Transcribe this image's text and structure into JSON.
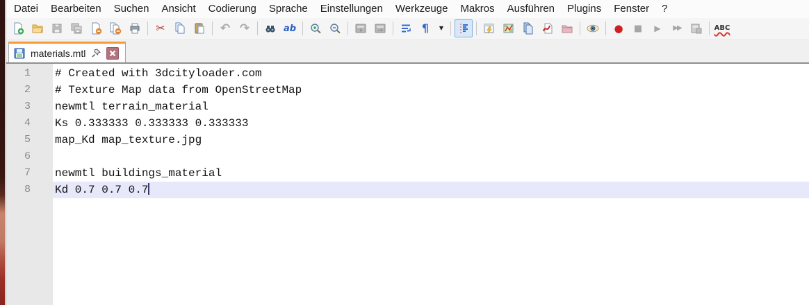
{
  "menu": {
    "items": [
      {
        "label": "Datei"
      },
      {
        "label": "Bearbeiten"
      },
      {
        "label": "Suchen"
      },
      {
        "label": "Ansicht"
      },
      {
        "label": "Codierung"
      },
      {
        "label": "Sprache"
      },
      {
        "label": "Einstellungen"
      },
      {
        "label": "Werkzeuge"
      },
      {
        "label": "Makros"
      },
      {
        "label": "Ausführen"
      },
      {
        "label": "Plugins"
      },
      {
        "label": "Fenster"
      },
      {
        "label": "?"
      }
    ]
  },
  "toolbar": {
    "icons": [
      {
        "name": "new-file",
        "glyph": "",
        "disabled": false
      },
      {
        "name": "open-file",
        "glyph": "",
        "disabled": false
      },
      {
        "name": "save",
        "glyph": "",
        "disabled": true
      },
      {
        "name": "save-all",
        "glyph": "",
        "disabled": true
      },
      {
        "name": "close-file",
        "glyph": "",
        "disabled": false
      },
      {
        "name": "close-all",
        "glyph": "",
        "disabled": false
      },
      {
        "name": "print",
        "glyph": "",
        "disabled": false
      },
      {
        "name": "cut",
        "glyph": "✂",
        "disabled": false
      },
      {
        "name": "copy",
        "glyph": "",
        "disabled": false
      },
      {
        "name": "paste",
        "glyph": "",
        "disabled": false
      },
      {
        "name": "undo",
        "glyph": "↶",
        "disabled": true
      },
      {
        "name": "redo",
        "glyph": "↷",
        "disabled": true
      },
      {
        "name": "find",
        "glyph": "",
        "disabled": false
      },
      {
        "name": "replace",
        "glyph": "ab",
        "disabled": false
      },
      {
        "name": "zoom-in",
        "glyph": "",
        "disabled": false
      },
      {
        "name": "zoom-out",
        "glyph": "",
        "disabled": false
      },
      {
        "name": "sync-scroll-vertical",
        "glyph": "",
        "disabled": true
      },
      {
        "name": "sync-scroll-horizontal",
        "glyph": "",
        "disabled": true
      },
      {
        "name": "word-wrap",
        "glyph": "",
        "disabled": false
      },
      {
        "name": "show-all-characters",
        "glyph": "¶",
        "disabled": false
      },
      {
        "name": "paragraph-dropdown",
        "glyph": "▼",
        "disabled": false
      },
      {
        "name": "indent-guide",
        "glyph": "",
        "disabled": false,
        "active": true
      },
      {
        "name": "function-list",
        "glyph": "",
        "disabled": false
      },
      {
        "name": "document-map",
        "glyph": "",
        "disabled": false
      },
      {
        "name": "document-switcher",
        "glyph": "",
        "disabled": false
      },
      {
        "name": "file-monitoring",
        "glyph": "",
        "disabled": false
      },
      {
        "name": "project-folder",
        "glyph": "",
        "disabled": true
      },
      {
        "name": "preview-eye",
        "glyph": "",
        "disabled": false
      },
      {
        "name": "macro-record",
        "glyph": "●",
        "disabled": false
      },
      {
        "name": "macro-stop",
        "glyph": "■",
        "disabled": true
      },
      {
        "name": "macro-play",
        "glyph": "▶",
        "disabled": true
      },
      {
        "name": "macro-run-multiple",
        "glyph": "▶▶",
        "disabled": true
      },
      {
        "name": "macro-save",
        "glyph": "",
        "disabled": true
      },
      {
        "name": "spell-check",
        "glyph": "ABC",
        "disabled": false
      }
    ]
  },
  "tab": {
    "title": "materials.mtl",
    "saved": true
  },
  "editor": {
    "lines": [
      {
        "num": "1",
        "text": "# Created with 3dcityloader.com"
      },
      {
        "num": "2",
        "text": "# Texture Map data from OpenStreetMap"
      },
      {
        "num": "3",
        "text": "newmtl terrain_material"
      },
      {
        "num": "4",
        "text": "Ks 0.333333 0.333333 0.333333"
      },
      {
        "num": "5",
        "text": "map_Kd map_texture.jpg"
      },
      {
        "num": "6",
        "text": ""
      },
      {
        "num": "7",
        "text": "newmtl buildings_material"
      },
      {
        "num": "8",
        "text": "Kd 0.7 0.7 0.7"
      }
    ],
    "cursor_line": 8
  },
  "colors": {
    "tab_accent": "#f49b38",
    "current_line_bg": "#e8e8fb",
    "gutter_bg": "#e8e8e8",
    "line_number": "#8a8a8a",
    "caret": "#3a3a6e"
  }
}
